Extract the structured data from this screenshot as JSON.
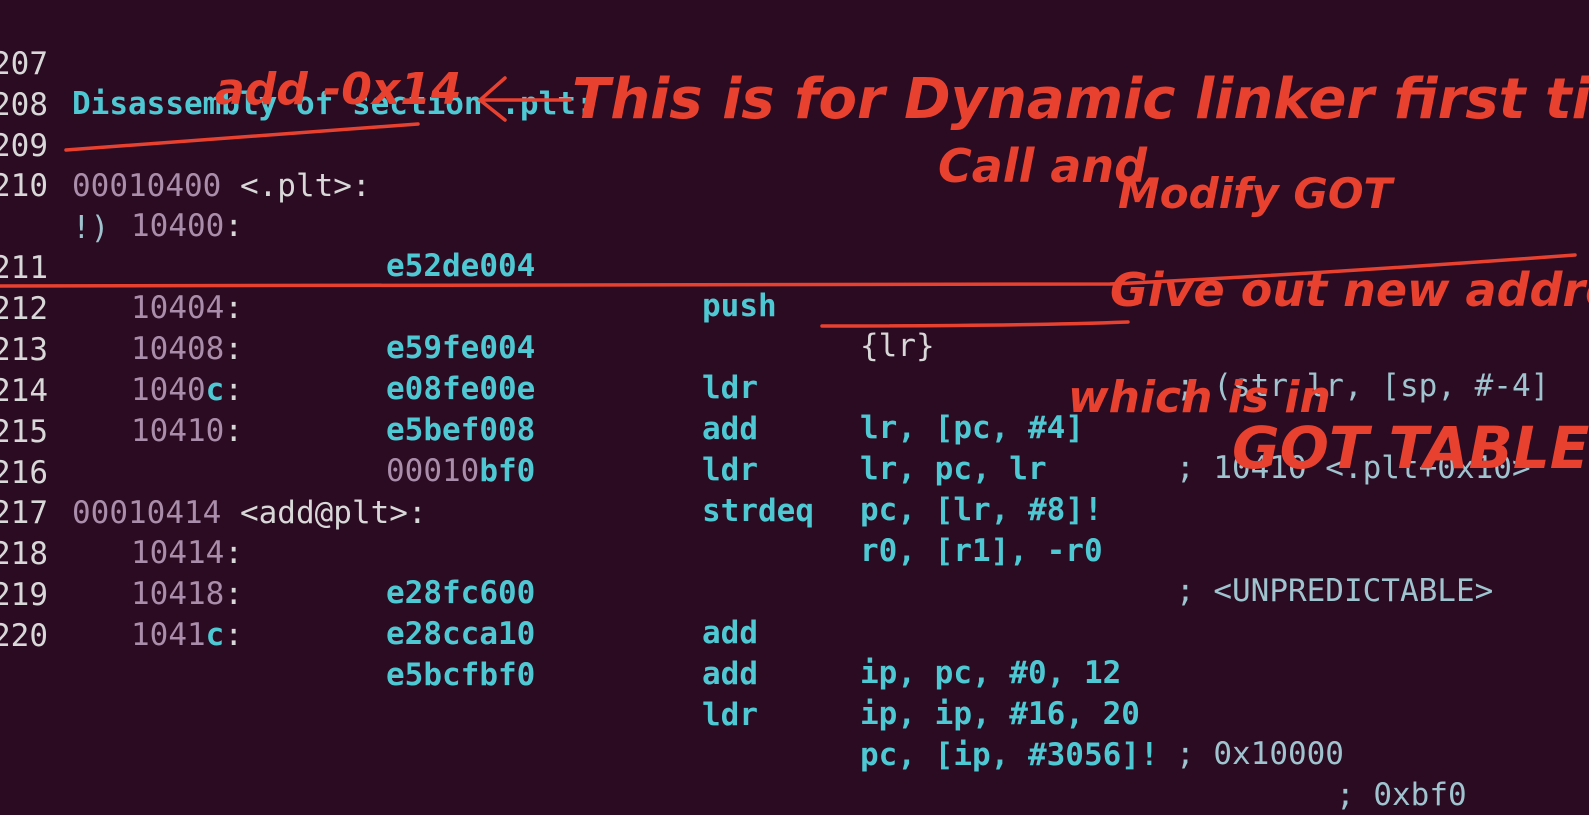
{
  "lines": [
    {
      "ln": "207",
      "kind": "section",
      "text": "Disassembly of section .plt:"
    },
    {
      "ln": "208",
      "kind": "blank"
    },
    {
      "ln": "209",
      "kind": "symbol",
      "addr": "00010400",
      "sym": "<.plt>:"
    },
    {
      "ln": "210",
      "kind": "insn",
      "addr": "10400",
      "addr_suffix": "",
      "hex_dim": "",
      "hex": "e52de004",
      "mnem": "push",
      "ops": "{lr}",
      "comment": "; (str lr, [sp, #-4]"
    },
    {
      "ln": "",
      "kind": "wrap",
      "text": "!)"
    },
    {
      "ln": "211",
      "kind": "insn",
      "addr": "10404",
      "addr_suffix": "",
      "hex_dim": "",
      "hex": "e59fe004",
      "mnem": "ldr",
      "ops": "lr, [pc, #4]",
      "comment": "; 10410 <.plt+0x10>"
    },
    {
      "ln": "212",
      "kind": "insn",
      "addr": "10408",
      "addr_suffix": "",
      "hex_dim": "",
      "hex": "e08fe00e",
      "mnem": "add",
      "ops": "lr, pc, lr",
      "comment": ""
    },
    {
      "ln": "213",
      "kind": "insn",
      "addr": "1040",
      "addr_suffix": "c",
      "hex_dim": "",
      "hex": "e5bef008",
      "mnem": "ldr",
      "ops": "pc, [lr, #8]!",
      "comment": ""
    },
    {
      "ln": "214",
      "kind": "insn",
      "addr": "10410",
      "addr_suffix": "",
      "hex_dim": "00010",
      "hex": "bf0",
      "mnem": "strdeq",
      "ops": "r0, [r1], -r0",
      "comment": "; <UNPREDICTABLE>"
    },
    {
      "ln": "215",
      "kind": "blank"
    },
    {
      "ln": "216",
      "kind": "symbol",
      "addr": "00010414",
      "sym": "<add@plt>:"
    },
    {
      "ln": "217",
      "kind": "insn",
      "addr": "10414",
      "addr_suffix": "",
      "hex_dim": "",
      "hex": "e28fc600",
      "mnem": "add",
      "ops": "ip, pc, #0, 12",
      "comment": ""
    },
    {
      "ln": "218",
      "kind": "insn",
      "addr": "10418",
      "addr_suffix": "",
      "hex_dim": "",
      "hex": "e28cca10",
      "mnem": "add",
      "ops": "ip, ip, #16, 20",
      "comment": "; 0x10000"
    },
    {
      "ln": "219",
      "kind": "insn",
      "addr": "1041",
      "addr_suffix": "c",
      "hex_dim": "",
      "hex": "e5bcfbf0",
      "mnem": "ldr",
      "ops": "pc, [ip, #3056]!",
      "comment": "; 0xbf0"
    },
    {
      "ln": "220",
      "kind": "blank"
    }
  ],
  "annotations": {
    "ink_color": "#e8412f",
    "note_add_offset": "add -0x14",
    "note_dynamic_linker": "This is for Dynamic linker first time to",
    "note_call_and": "Call and",
    "note_modify_got": "Modify GOT",
    "note_give_out": "Give out new address",
    "note_which_is_in": "which is in",
    "note_got_table": "GOT TABLE"
  }
}
